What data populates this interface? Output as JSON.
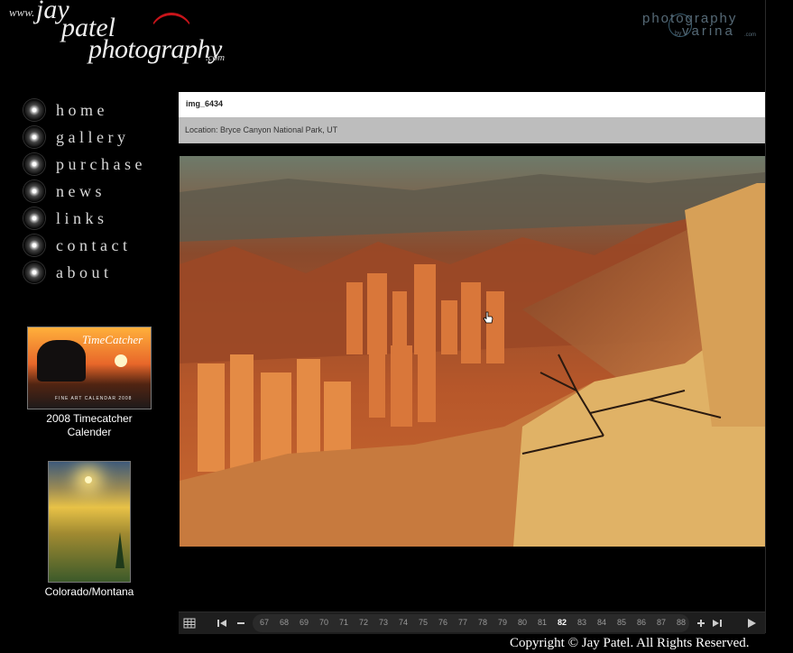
{
  "logo": {
    "www": "www.",
    "jay": "jay",
    "patel": "patel",
    "photography": "photography",
    "dotcom": ".com"
  },
  "partner_logo": {
    "line1": "photography",
    "by": "by",
    "line2": "varina",
    "com": ".com"
  },
  "nav": {
    "items": [
      {
        "label": "home"
      },
      {
        "label": "gallery"
      },
      {
        "label": "purchase"
      },
      {
        "label": "news"
      },
      {
        "label": "links"
      },
      {
        "label": "contact"
      },
      {
        "label": "about"
      }
    ]
  },
  "promos": [
    {
      "thumb_title": "TimeCatcher",
      "thumb_sub": "FINE ART CALENDAR 2008",
      "caption": "2008 Timecatcher Calender"
    },
    {
      "caption": "Colorado/Montana"
    }
  ],
  "image": {
    "title": "img_6434",
    "location": "Location: Bryce Canyon National Park, UT"
  },
  "thumbbar": {
    "pages": [
      "67",
      "68",
      "69",
      "70",
      "71",
      "72",
      "73",
      "74",
      "75",
      "76",
      "77",
      "78",
      "79",
      "80",
      "81",
      "82",
      "83",
      "84",
      "85",
      "86",
      "87",
      "88"
    ],
    "current": "82",
    "icons": [
      "grid-icon",
      "first-icon",
      "minus-icon",
      "plus-icon",
      "last-icon",
      "play-icon"
    ]
  },
  "footer": {
    "copyright": "Copyright © Jay Patel. All Rights Reserved."
  },
  "colors": {
    "accent_red": "#c8141a",
    "titlebar": "#ffffff",
    "infobar": "#bdbdbd",
    "thumbbar": "#1e1e1e"
  }
}
